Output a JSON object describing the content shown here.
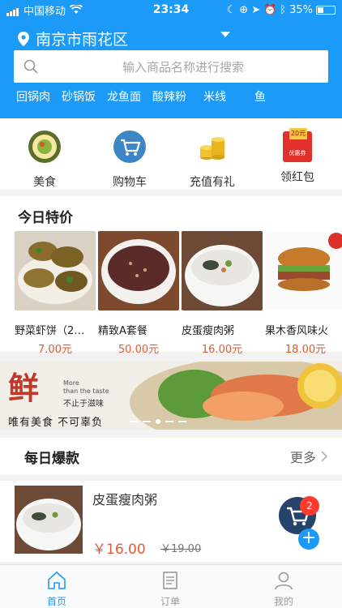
{
  "status": {
    "carrier": "中国移动",
    "time": "23:34",
    "battery": "35%"
  },
  "location": {
    "city": "南京市雨花区"
  },
  "search": {
    "placeholder": "输入商品名称进行搜索"
  },
  "hot_tags": [
    "回锅肉",
    "砂锅饭",
    "龙鱼面",
    "酸辣粉",
    "米线",
    "鱼"
  ],
  "categories": [
    {
      "label": "美食",
      "icon": "food-icon"
    },
    {
      "label": "购物车",
      "icon": "cart-icon"
    },
    {
      "label": "充值有礼",
      "icon": "coins-icon"
    },
    {
      "label": "领红包",
      "icon": "red-envelope-icon",
      "tag": "20元",
      "sub": "优惠券"
    }
  ],
  "today": {
    "title": "今日特价",
    "products": [
      {
        "name": "野菜虾饼（2…",
        "price": "7.00元"
      },
      {
        "name": "精致A套餐",
        "price": "50.00元"
      },
      {
        "name": "皮蛋瘦肉粥",
        "price": "16.00元"
      },
      {
        "name": "果木香风味火",
        "price": "18.00元"
      }
    ]
  },
  "banner": {
    "big_char": "鲜",
    "line1": "More",
    "line2": "than the taste",
    "line3": "不止于滋味",
    "slogan": "唯有美食  不可辜负"
  },
  "daily": {
    "title": "每日爆款",
    "more": "更多",
    "item": {
      "name": "皮蛋瘦肉粥",
      "price": "￥16.00",
      "old_price": "￥19.00"
    }
  },
  "cart": {
    "count": "2"
  },
  "tabs": [
    {
      "label": "首页",
      "active": true
    },
    {
      "label": "订单",
      "active": false
    },
    {
      "label": "我的",
      "active": false
    }
  ],
  "colors": {
    "primary": "#1b9af7",
    "price": "#e05b2f",
    "badge": "#ff3b30"
  }
}
